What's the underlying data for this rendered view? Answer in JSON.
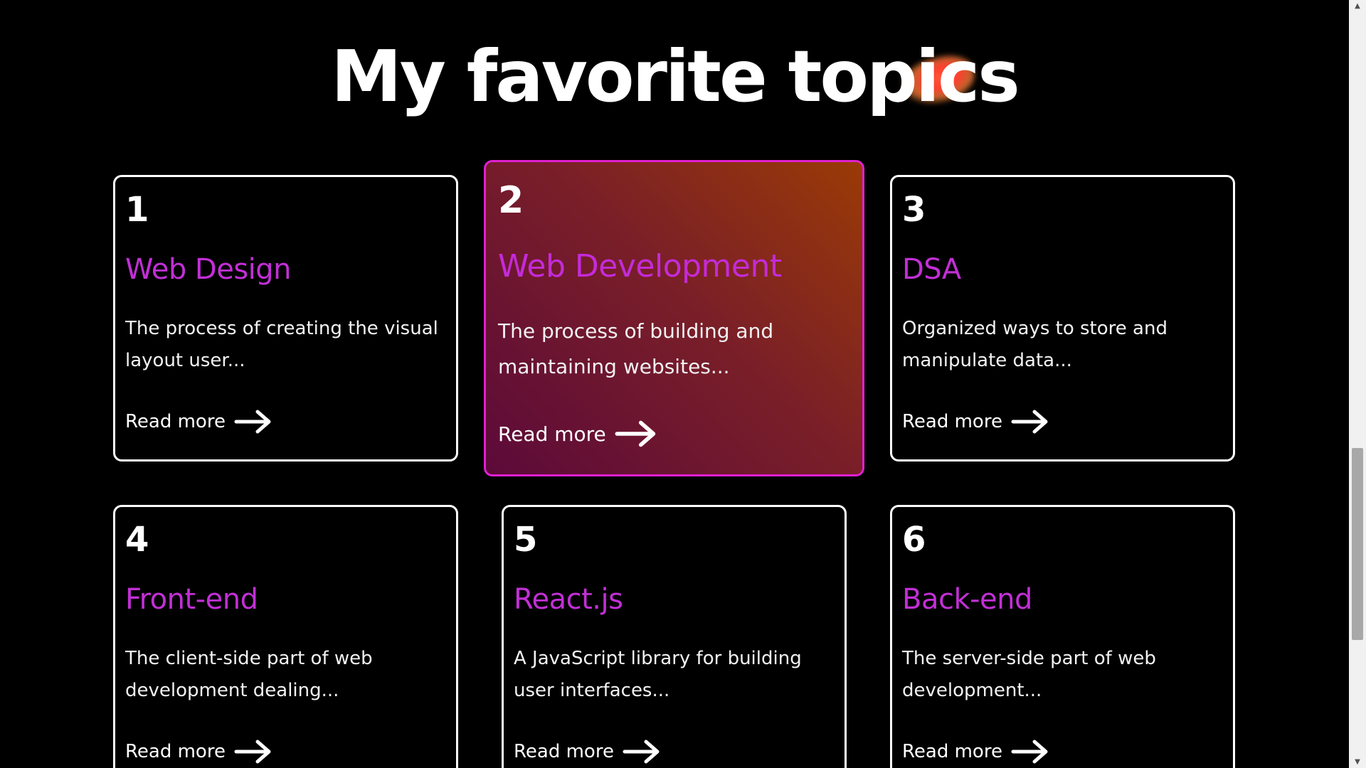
{
  "page": {
    "heading": "My favorite topics"
  },
  "cards": [
    {
      "number": "1",
      "title": "Web Design",
      "description": "The process of creating the visual layout user...",
      "link": "Read more"
    },
    {
      "number": "2",
      "title": "Web Development",
      "description": "The process of building and maintaining websites...",
      "link": "Read more"
    },
    {
      "number": "3",
      "title": "DSA",
      "description": "Organized ways to store and manipulate data...",
      "link": "Read more"
    },
    {
      "number": "4",
      "title": "Front-end",
      "description": "The client-side part of web development dealing...",
      "link": "Read more"
    },
    {
      "number": "5",
      "title": "React.js",
      "description": "A JavaScript library for building user interfaces...",
      "link": "Read more"
    },
    {
      "number": "6",
      "title": "Back-end",
      "description": "The server-side part of web development...",
      "link": "Read more"
    }
  ],
  "colors": {
    "background": "#000000",
    "title_accent": "#c22fd6",
    "featured_border": "#e020d0",
    "featured_gradient_start": "#9a3a06",
    "featured_gradient_end": "#5c0a3a"
  },
  "icons": {
    "arrow": "arrow-right-icon",
    "decoration": "paint-splash-icon"
  }
}
